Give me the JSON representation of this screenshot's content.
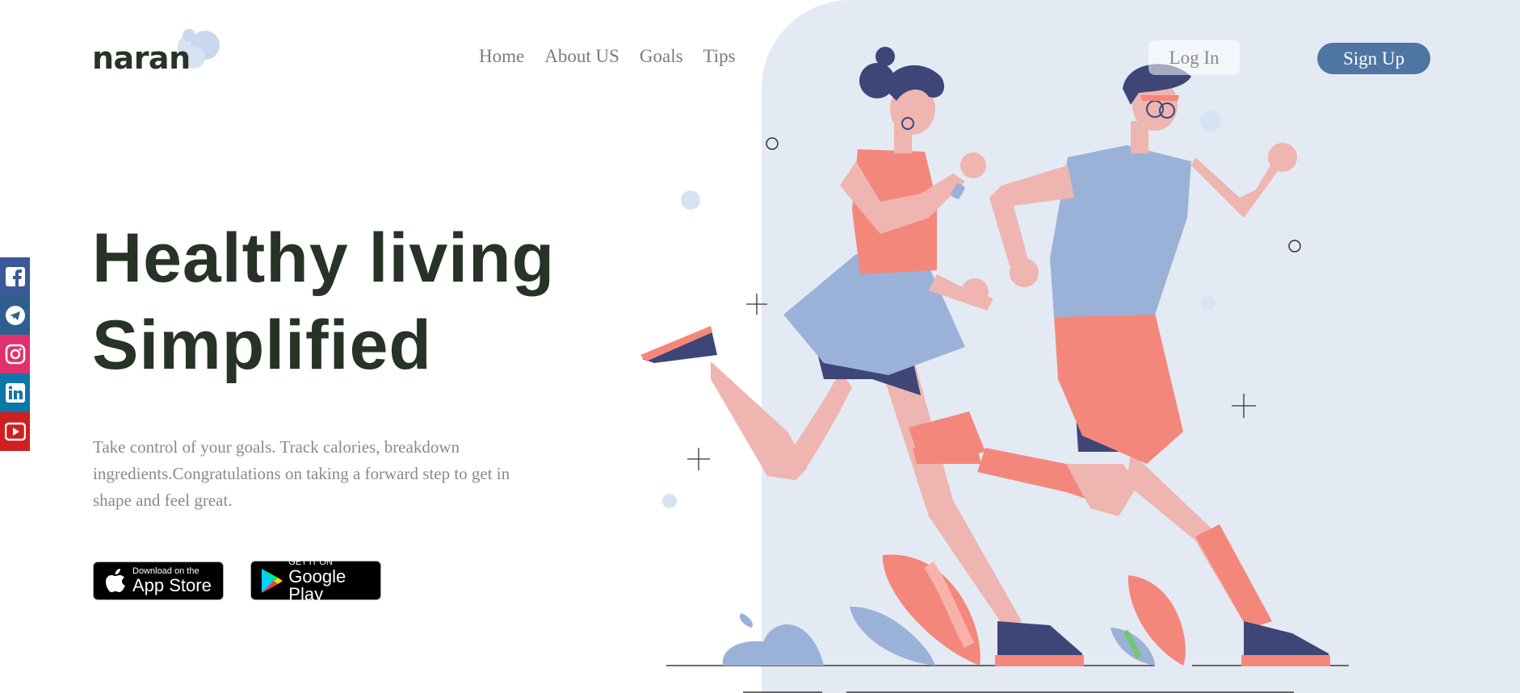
{
  "brand": {
    "name": "naran",
    "icon": "cloud-icon"
  },
  "nav": {
    "items": [
      "Home",
      "About US",
      "Goals",
      "Tips"
    ]
  },
  "auth": {
    "login_label": "Log In",
    "signup_label": "Sign Up"
  },
  "hero": {
    "title_line1": "Healthy living",
    "title_line2": "Simplified",
    "description": "Take control of your goals. Track calories, breakdown ingredients.Congratulations on taking a forward step to get in shape and feel great."
  },
  "badges": {
    "appstore": {
      "small": "Download on the",
      "big": "App Store"
    },
    "googleplay": {
      "small": "GET IT ON",
      "big": "Google Play"
    }
  },
  "social": [
    "facebook-icon",
    "telegram-icon",
    "instagram-icon",
    "linkedin-icon",
    "youtube-icon"
  ],
  "colors": {
    "accent": "#4e75a3",
    "heading": "#263326",
    "panel": "#e4eaf3",
    "coral": "#f4877c",
    "navy": "#3d4677",
    "blue": "#9bb2d8",
    "skin": "#efb5b0"
  }
}
